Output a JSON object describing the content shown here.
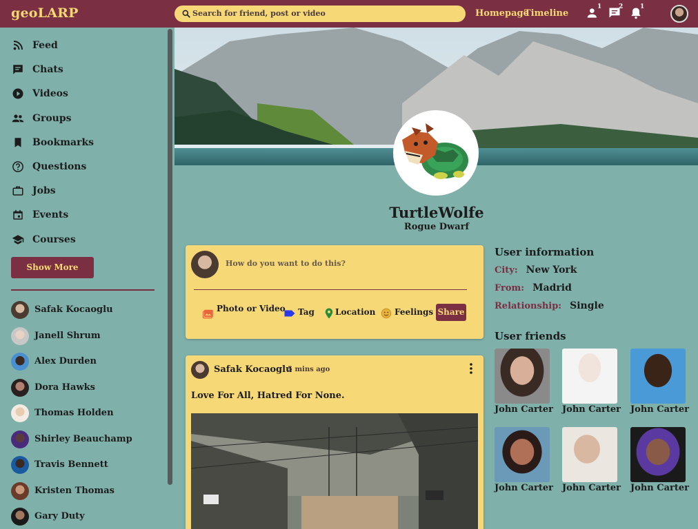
{
  "app": {
    "logo": "geoLARP"
  },
  "colors": {
    "topbar": "#7a2f43",
    "accent_yellow": "#f6d876",
    "background": "#7fb0aa"
  },
  "search": {
    "placeholder": "Search for friend, post or video",
    "icon": "search-icon"
  },
  "topnav": {
    "links": [
      "Homepage",
      "Timeline"
    ],
    "icons": [
      {
        "name": "person-icon",
        "badge": "1"
      },
      {
        "name": "chat-icon",
        "badge": "2"
      },
      {
        "name": "bell-icon",
        "badge": "1"
      }
    ]
  },
  "sidebar": {
    "items": [
      {
        "label": "Feed",
        "icon": "rss-icon"
      },
      {
        "label": "Chats",
        "icon": "chat-icon"
      },
      {
        "label": "Videos",
        "icon": "play-icon"
      },
      {
        "label": "Groups",
        "icon": "group-icon"
      },
      {
        "label": "Bookmarks",
        "icon": "bookmark-icon"
      },
      {
        "label": "Questions",
        "icon": "help-icon"
      },
      {
        "label": "Jobs",
        "icon": "briefcase-icon"
      },
      {
        "label": "Events",
        "icon": "calendar-icon"
      },
      {
        "label": "Courses",
        "icon": "school-icon"
      }
    ],
    "show_more": "Show More",
    "friends": [
      "Safak Kocaoglu",
      "Janell Shrum",
      "Alex Durden",
      "Dora Hawks",
      "Thomas Holden",
      "Shirley Beauchamp",
      "Travis Bennett",
      "Kristen Thomas",
      "Gary Duty"
    ]
  },
  "profile": {
    "name": "TurtleWolfe",
    "subtitle": "Rogue Dwarf"
  },
  "composer": {
    "placeholder": "How do you want to do this?",
    "options": [
      "Photo or Video",
      "Tag",
      "Location",
      "Feelings"
    ],
    "share": "Share"
  },
  "post": {
    "author": "Safak Kocaoglu",
    "time": "5 mins ago",
    "text": "Love For All, Hatred For None."
  },
  "user_info": {
    "title": "User information",
    "rows": [
      {
        "key": "City:",
        "value": "New York"
      },
      {
        "key": "From:",
        "value": "Madrid"
      },
      {
        "key": "Relationship:",
        "value": "Single"
      }
    ]
  },
  "user_friends": {
    "title": "User friends",
    "items": [
      "John Carter",
      "John Carter",
      "John Carter",
      "John Carter",
      "John Carter",
      "John Carter"
    ]
  }
}
